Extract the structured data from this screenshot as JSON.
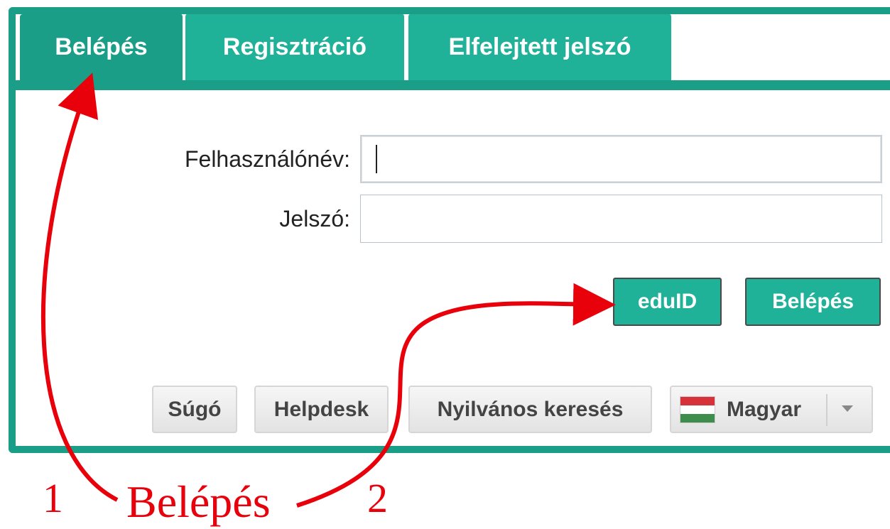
{
  "tabs": [
    {
      "label": "Belépés",
      "active": true
    },
    {
      "label": "Regisztráció",
      "active": false
    },
    {
      "label": "Elfelejtett jelszó",
      "active": false
    }
  ],
  "form": {
    "username_label": "Felhasználónév:",
    "username_value": "",
    "password_label": "Jelszó:",
    "password_value": ""
  },
  "buttons": {
    "eduid": "eduID",
    "login": "Belépés"
  },
  "footer": {
    "help": "Súgó",
    "helpdesk": "Helpdesk",
    "public_search": "Nyilvános keresés",
    "language": "Magyar"
  },
  "annotation": {
    "word": "Belépés",
    "marker_1": "1",
    "marker_2": "2"
  },
  "colors": {
    "accent": "#1a9e88",
    "tab_bg": "#20b298",
    "annotation": "#e8000b"
  }
}
